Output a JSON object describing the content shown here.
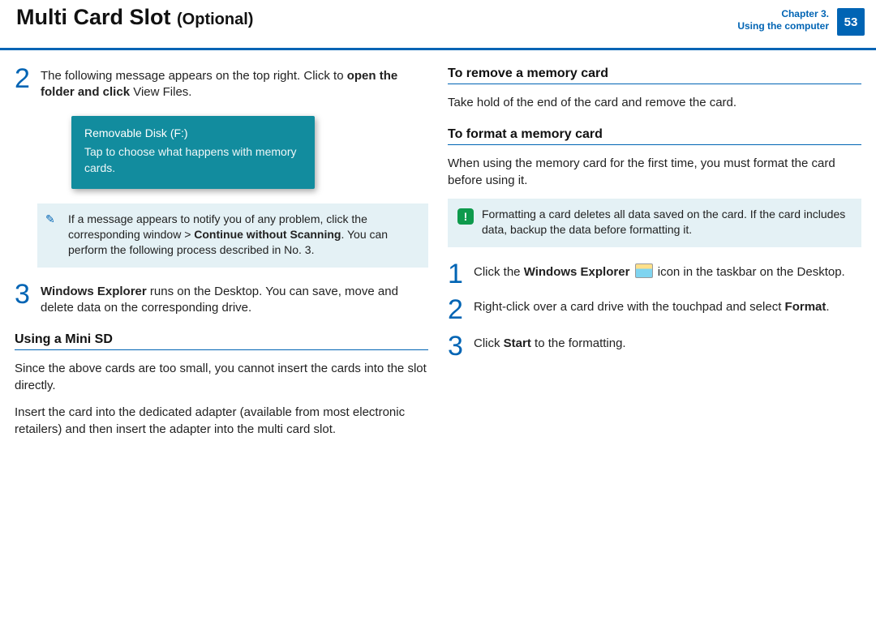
{
  "header": {
    "title_main": "Multi Card Slot",
    "title_secondary": "(Optional)",
    "chapter_line1": "Chapter 3.",
    "chapter_line2": "Using the computer",
    "page_number": "53"
  },
  "left": {
    "step2": {
      "num": "2",
      "text_a": "The following message appears on the top right. Click to ",
      "text_b_bold": "open the folder and click",
      "text_c": " View Files."
    },
    "popup": {
      "title": "Removable Disk (F:)",
      "body": "Tap to choose what happens with memory cards."
    },
    "note": {
      "text_a": "If a message appears to notify you of any problem, click the corresponding window > ",
      "text_b_bold": "Continue without Scanning",
      "text_c": ". You can perform the following process described in No. 3."
    },
    "step3": {
      "num": "3",
      "text_a_bold": "Windows Explorer",
      "text_b": " runs on the Desktop. You can save, move and delete data on the corresponding drive."
    },
    "h_mini": "Using a Mini SD",
    "mini_p1": "Since the above cards are too small, you cannot insert the cards into the slot directly.",
    "mini_p2": "Insert the card into the dedicated adapter (available from most electronic retailers) and then insert the adapter into the multi card slot."
  },
  "right": {
    "h_remove": "To remove a memory card",
    "remove_p": "Take hold of the end of the card and remove the card.",
    "h_format": "To format a memory card",
    "format_p": "When using the memory card for the first time, you must format the card before using it.",
    "warn": "Formatting a card deletes all data saved on the card. If the card includes data, backup the data before formatting it.",
    "warn_mark": "!",
    "step1": {
      "num": "1",
      "text_a": "Click the ",
      "text_b_bold": "Windows Explorer",
      "text_c": " icon in the taskbar on the Desktop."
    },
    "step2": {
      "num": "2",
      "text_a": "Right-click over a card drive with the touchpad and select ",
      "text_b_bold": "Format",
      "text_c": "."
    },
    "step3": {
      "num": "3",
      "text_a": "Click ",
      "text_b_bold": "Start",
      "text_c": " to the formatting."
    }
  }
}
